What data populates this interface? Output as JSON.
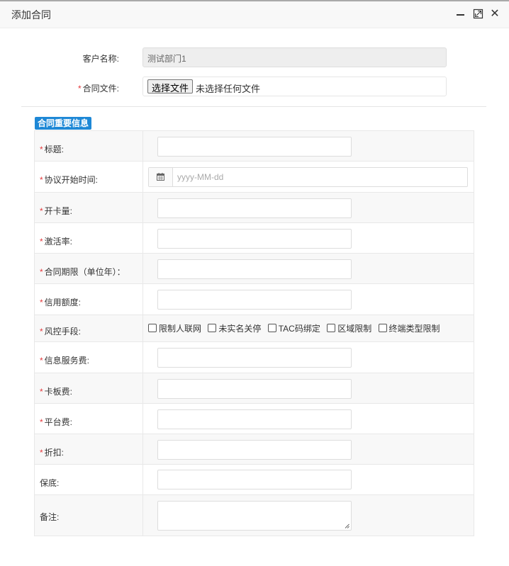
{
  "window": {
    "title": "添加合同"
  },
  "customer": {
    "label": "客户名称:",
    "value": "测试部门1"
  },
  "contract_file": {
    "label": "合同文件:",
    "button": "选择文件",
    "status": "未选择任何文件"
  },
  "section": {
    "title": "合同重要信息"
  },
  "fields": {
    "title": {
      "label": "标题:",
      "value": ""
    },
    "start_date": {
      "label": "协议开始时间:",
      "placeholder": "yyyy-MM-dd"
    },
    "card_volume": {
      "label": "开卡量:",
      "value": ""
    },
    "activation_rate": {
      "label": "激活率:",
      "value": ""
    },
    "term": {
      "label": "合同期限（单位年）：",
      "value": ""
    },
    "credit_limit": {
      "label": "信用额度:",
      "value": ""
    },
    "risk_control": {
      "label": "风控手段:",
      "options": [
        "限制人联网",
        "未实名关停",
        "TAC码绑定",
        "区域限制",
        "终端类型限制"
      ]
    },
    "info_service_fee": {
      "label": "信息服务费:",
      "value": ""
    },
    "card_fee": {
      "label": "卡板费:",
      "value": ""
    },
    "platform_fee": {
      "label": "平台费:",
      "value": ""
    },
    "discount": {
      "label": "折扣:",
      "value": ""
    },
    "guarantee": {
      "label": "保底:",
      "value": ""
    },
    "remark": {
      "label": "备注:",
      "value": ""
    }
  }
}
